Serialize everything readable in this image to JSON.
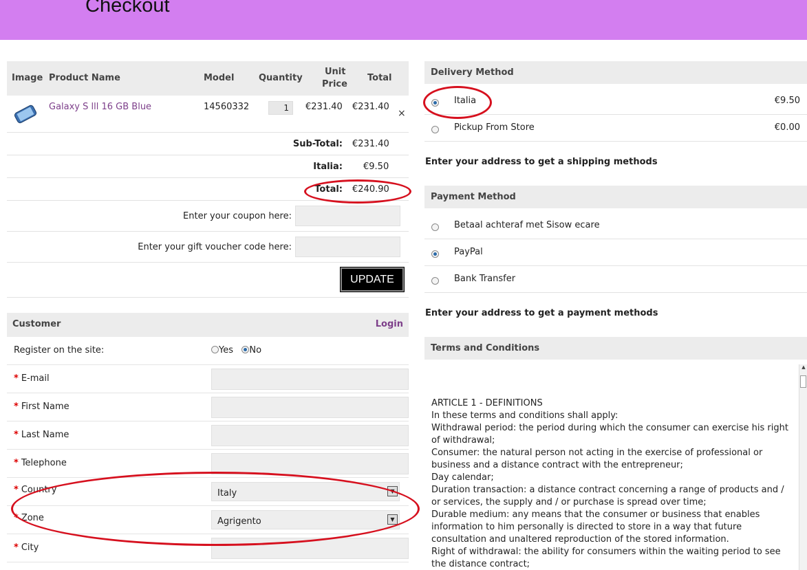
{
  "page": {
    "title": "Checkout"
  },
  "cart": {
    "headers": {
      "image": "Image",
      "product_name": "Product Name",
      "model": "Model",
      "quantity": "Quantity",
      "unit_price_1": "Unit",
      "unit_price_2": "Price",
      "total": "Total"
    },
    "item": {
      "name": "Galaxy S lll 16 GB Blue",
      "model": "14560332",
      "quantity": "1",
      "unit_price": "€231.40",
      "total": "€231.40",
      "remove": "×"
    },
    "subtotal": {
      "label": "Sub-Total:",
      "value": "€231.40"
    },
    "shipping": {
      "label": "Italia:",
      "value": "€9.50"
    },
    "total": {
      "label": "Total:",
      "value": "€240.90"
    },
    "coupon_label": "Enter your coupon here:",
    "voucher_label": "Enter your gift voucher code here:",
    "update_label": "UPDATE"
  },
  "customer": {
    "title": "Customer",
    "login": "Login",
    "register_label": "Register on the site:",
    "register_yes": "Yes",
    "register_no": "No",
    "email": "E-mail",
    "first_name": "First Name",
    "last_name": "Last Name",
    "telephone": "Telephone",
    "country": "Country",
    "country_value": "Italy",
    "zone": "Zone",
    "zone_value": "Agrigento",
    "city": "City"
  },
  "delivery": {
    "title": "Delivery Method",
    "options": [
      {
        "name": "Italia",
        "price": "€9.50",
        "selected": true
      },
      {
        "name": "Pickup From Store",
        "price": "€0.00",
        "selected": false
      }
    ],
    "note": "Enter your address to get a shipping methods"
  },
  "payment": {
    "title": "Payment Method",
    "options": [
      {
        "name": "Betaal achteraf met Sisow ecare"
      },
      {
        "name": "PayPal"
      },
      {
        "name": "Bank Transfer"
      }
    ],
    "note": "Enter your address to get a payment methods"
  },
  "terms": {
    "title": "Terms and Conditions",
    "lines": [
      "ARTICLE 1 - DEFINITIONS",
      "In these terms and conditions shall apply:",
      "Withdrawal period: the period during which the consumer can exercise his right of withdrawal;",
      "Consumer: the natural person not acting in the exercise of professional or business and a distance contract with the entrepreneur;",
      "Day calendar;",
      "Duration transaction: a distance contract concerning a range of products and / or services, the supply and / or purchase is spread over time;",
      "Durable medium: any means that the consumer or business that enables information to him personally is directed to store in a way that future consultation and unaltered reproduction of the stored information.",
      "Right of withdrawal: the ability for consumers within the waiting period to see the distance contract;"
    ]
  },
  "colors": {
    "header": "#d37ef0",
    "link": "#7d3f8a",
    "annotation": "#d6101e"
  }
}
